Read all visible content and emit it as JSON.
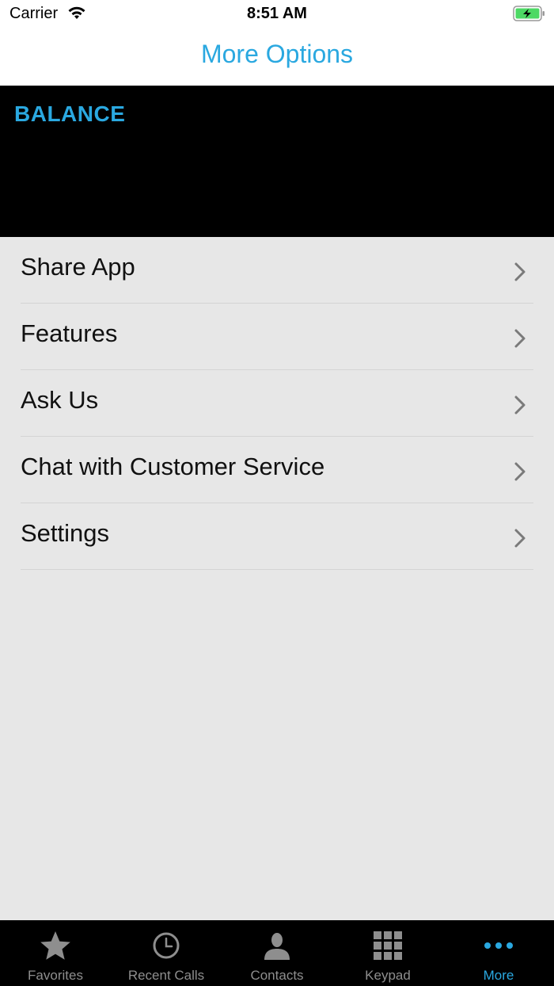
{
  "status_bar": {
    "carrier": "Carrier",
    "time": "8:51 AM",
    "icons": [
      "wifi-icon",
      "battery-charging-icon"
    ]
  },
  "nav": {
    "title": "More Options"
  },
  "balance": {
    "label": "BALANCE"
  },
  "menu": {
    "items": [
      {
        "label": "Share App",
        "icon": "chevron-right-icon"
      },
      {
        "label": "Features",
        "icon": "chevron-right-icon"
      },
      {
        "label": "Ask Us",
        "icon": "chevron-right-icon"
      },
      {
        "label": "Chat with Customer Service",
        "icon": "chevron-right-icon"
      },
      {
        "label": "Settings",
        "icon": "chevron-right-icon"
      }
    ]
  },
  "tab_bar": {
    "tabs": [
      {
        "label": "Favorites",
        "icon": "star-icon",
        "active": false
      },
      {
        "label": "Recent Calls",
        "icon": "clock-icon",
        "active": false
      },
      {
        "label": "Contacts",
        "icon": "person-icon",
        "active": false
      },
      {
        "label": "Keypad",
        "icon": "keypad-icon",
        "active": false
      },
      {
        "label": "More",
        "icon": "more-dots-icon",
        "active": true
      }
    ]
  },
  "colors": {
    "accent": "#2aa8e0",
    "background": "#e7e7e7",
    "panel": "#000000",
    "tab_inactive": "#8e8e8e",
    "battery": "#4cd964"
  }
}
